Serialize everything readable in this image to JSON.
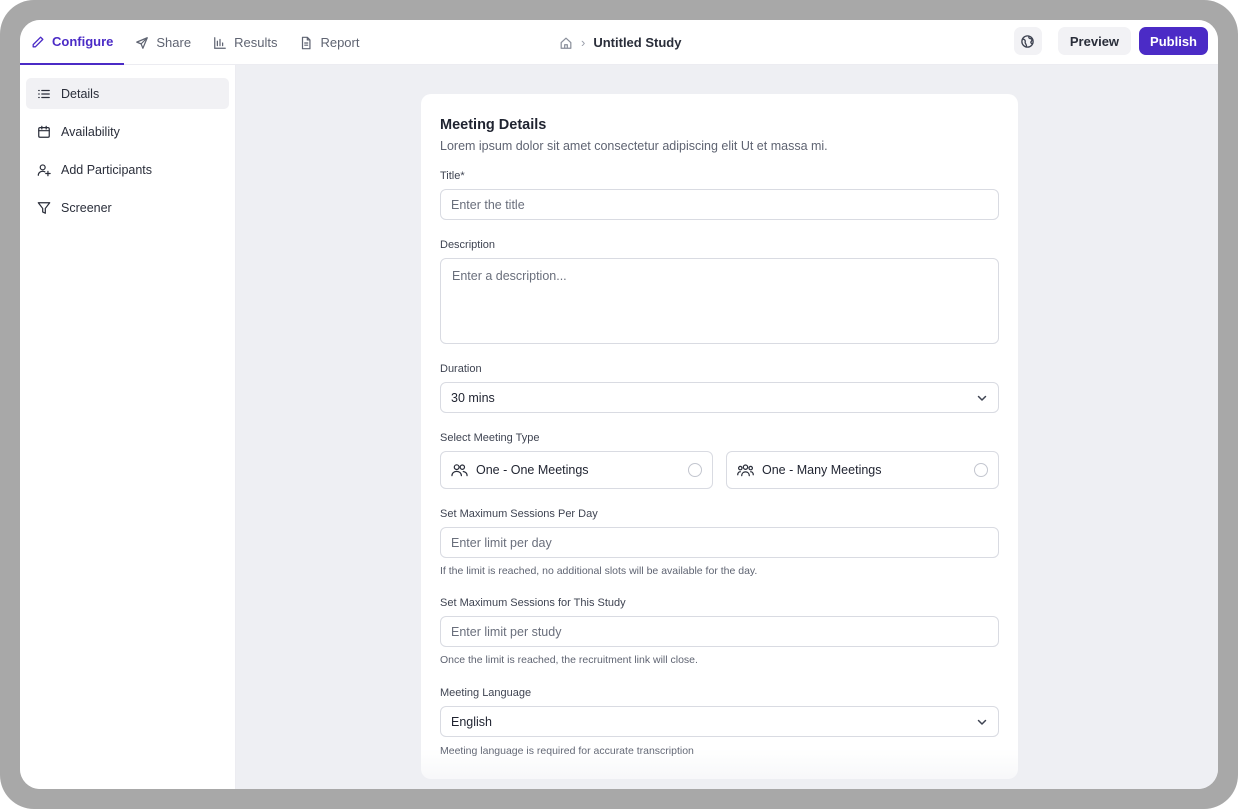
{
  "tabs": [
    {
      "label": "Configure",
      "icon": "pencil-icon",
      "active": true
    },
    {
      "label": "Share",
      "icon": "send-icon",
      "active": false
    },
    {
      "label": "Results",
      "icon": "chart-icon",
      "active": false
    },
    {
      "label": "Report",
      "icon": "document-icon",
      "active": false
    }
  ],
  "breadcrumb": {
    "home_icon": "home-icon",
    "separator": "›",
    "title": "Untitled Study"
  },
  "actions": {
    "preview": "Preview",
    "publish": "Publish",
    "globe_icon": "globe-icon"
  },
  "sidebar": {
    "items": [
      {
        "label": "Details",
        "icon": "list-icon",
        "active": true
      },
      {
        "label": "Availability",
        "icon": "calendar-icon",
        "active": false
      },
      {
        "label": "Add Participants",
        "icon": "user-plus-icon",
        "active": false
      },
      {
        "label": "Screener",
        "icon": "filter-icon",
        "active": false
      }
    ]
  },
  "form": {
    "title": "Meeting Details",
    "subtitle": "Lorem ipsum dolor sit amet consectetur adipiscing elit Ut et massa mi.",
    "title_label": "Title*",
    "title_placeholder": "Enter the title",
    "description_label": "Description",
    "description_placeholder": "Enter a description...",
    "duration_label": "Duration",
    "duration_value": "30 mins",
    "meeting_type_label": "Select Meeting Type",
    "meeting_types": [
      "One - One Meetings",
      "One - Many Meetings"
    ],
    "sessions_day_label": "Set Maximum Sessions Per Day",
    "sessions_day_placeholder": "Enter limit per day",
    "sessions_day_hint": "If the limit is reached, no additional slots will be available for the day.",
    "sessions_study_label": "Set Maximum Sessions for This Study",
    "sessions_study_placeholder": "Enter limit per study",
    "sessions_study_hint": "Once the limit is reached, the recruitment link will close.",
    "language_label": "Meeting Language",
    "language_value": "English",
    "language_hint": "Meeting language is required for accurate transcription"
  },
  "colors": {
    "accent": "#4b2bc6",
    "page_bg": "#eeeff3",
    "border": "#d9dbe2"
  }
}
